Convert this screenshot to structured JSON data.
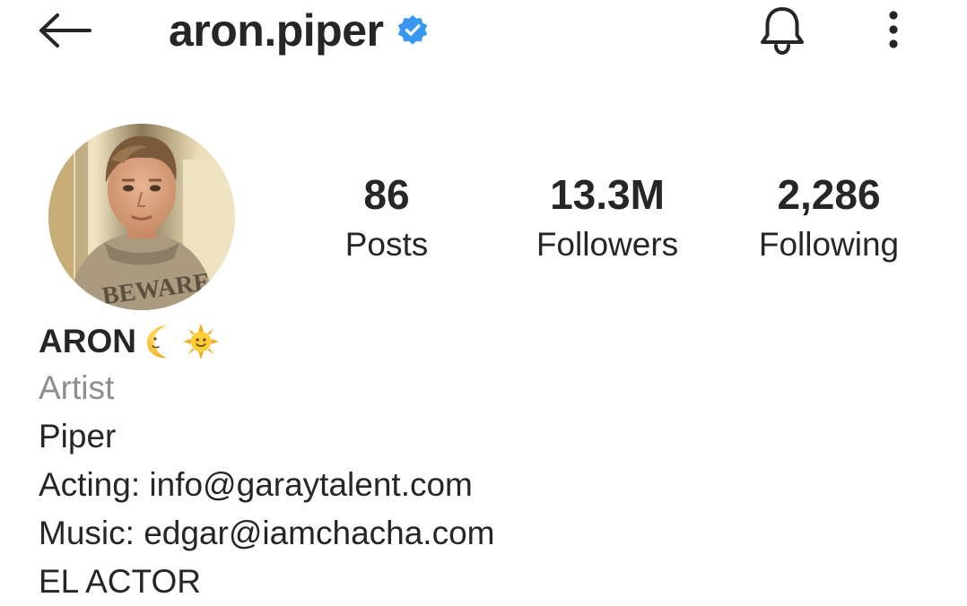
{
  "header": {
    "username": "aron.piper",
    "verified": true,
    "verified_color": "#3897f0",
    "icons": [
      "back-arrow-icon",
      "verified-badge-icon",
      "bell-icon",
      "more-vertical-icon"
    ]
  },
  "profile": {
    "avatar_icon": "profile-photo",
    "stats": {
      "posts": {
        "value": "86",
        "label": "Posts"
      },
      "followers": {
        "value": "13.3M",
        "label": "Followers"
      },
      "following": {
        "value": "2,286",
        "label": "Following"
      }
    }
  },
  "bio": {
    "name": "ARON",
    "name_emojis": [
      "crescent-moon-icon",
      "sun-with-face-icon"
    ],
    "category": "Artist",
    "lines": {
      "line1": "Piper",
      "acting_prefix": "Acting: ",
      "acting_email": "info@garaytalent.com",
      "music_prefix": "Music: ",
      "music_email": "edgar@iamchacha.com",
      "line4": "EL ACTOR"
    }
  },
  "colors": {
    "text": "#262626",
    "secondary_text": "#8e8e8e",
    "background": "#ffffff",
    "verified": "#3897f0"
  }
}
